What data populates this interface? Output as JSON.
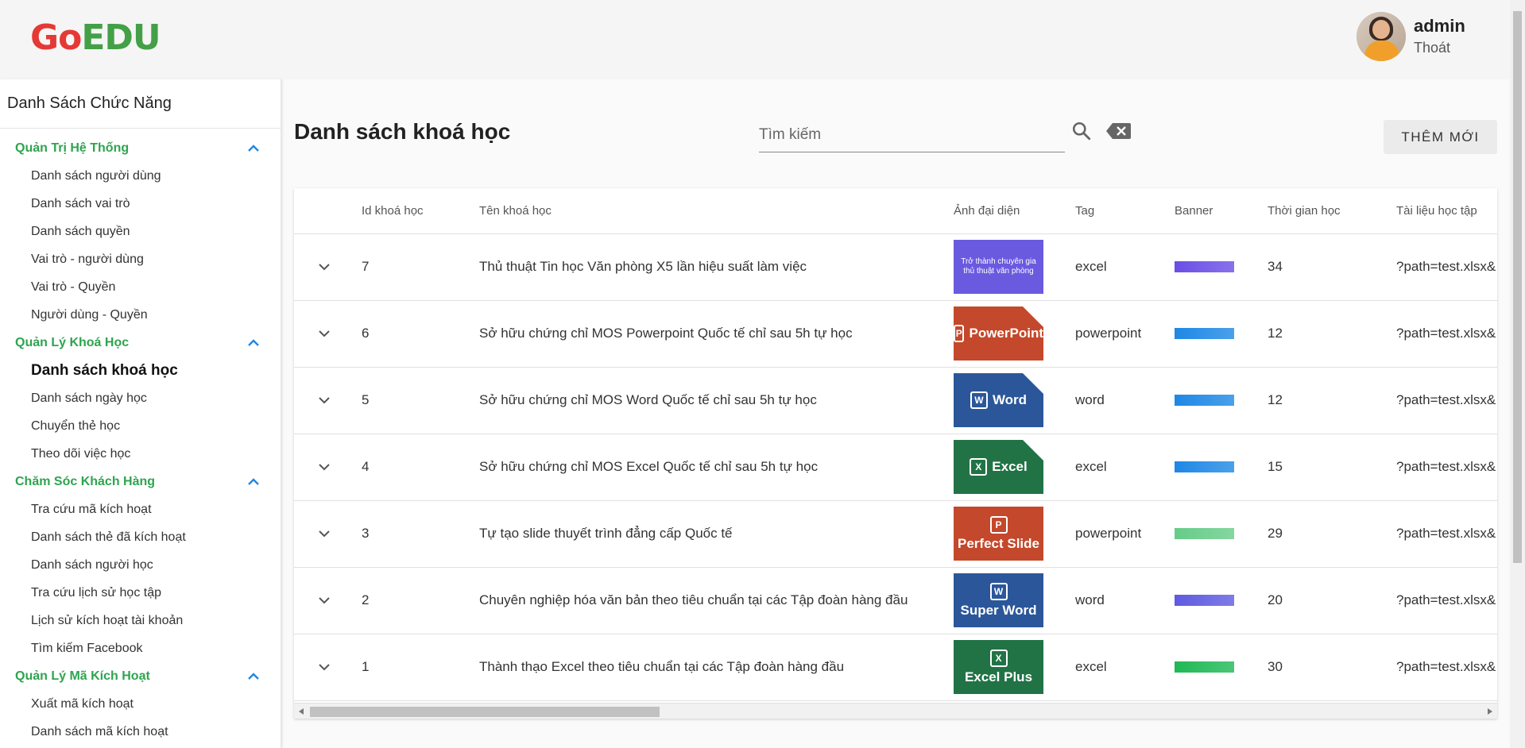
{
  "header": {
    "logo": {
      "go": "Go",
      "edu": "EDU"
    },
    "user": {
      "name": "admin",
      "logout": "Thoát"
    }
  },
  "sidebar": {
    "title": "Danh Sách Chức Năng",
    "groups": [
      {
        "label": "Quản Trị Hệ Thống",
        "items": [
          "Danh sách người dùng",
          "Danh sách vai trò",
          "Danh sách quyền",
          "Vai trò - người dùng",
          "Vai trò - Quyền",
          "Người dùng - Quyền"
        ]
      },
      {
        "label": "Quản Lý Khoá Học",
        "items": [
          "Danh sách khoá học",
          "Danh sách ngày học",
          "Chuyển thẻ học",
          "Theo dõi việc học"
        ]
      },
      {
        "label": "Chăm Sóc Khách Hàng",
        "items": [
          "Tra cứu mã kích hoạt",
          "Danh sách thẻ đã kích hoạt",
          "Danh sách người học",
          "Tra cứu lịch sử học tập",
          "Lịch sử kích hoạt tài khoản",
          "Tìm kiếm Facebook"
        ]
      },
      {
        "label": "Quản Lý Mã Kích Hoạt",
        "items": [
          "Xuất mã kích hoạt",
          "Danh sách mã kích hoạt"
        ]
      }
    ],
    "active_item": "Danh sách khoá học"
  },
  "main": {
    "title": "Danh sách khoá học",
    "search_placeholder": "Tìm kiếm",
    "search_value": "",
    "add_button": "THÊM MỚI"
  },
  "table": {
    "headers": [
      "",
      "Id khoá học",
      "Tên khoá học",
      "Ảnh đại diện",
      "Tag",
      "Banner",
      "Thời gian học",
      "Tài liệu học tập"
    ],
    "rows": [
      {
        "id": "7",
        "name": "Thủ thuật Tin học Văn phòng X5 lần hiệu suất làm việc",
        "thumb": {
          "kind": "office",
          "color": "#6a5ae0",
          "line1": "Trở thành chuyên gia",
          "line2": "thủ thuật văn phòng"
        },
        "tag": "excel",
        "banner_color": "#6b4ee6",
        "time": "34",
        "doc": "?path=test.xlsx&"
      },
      {
        "id": "6",
        "name": "Sở hữu chứng chỉ MOS Powerpoint Quốc tế chỉ sau 5h tự học",
        "thumb": {
          "kind": "mos",
          "color": "#c4482b",
          "sym": "P",
          "label": "PowerPoint"
        },
        "tag": "powerpoint",
        "banner_color": "#1e88e5",
        "time": "12",
        "doc": "?path=test.xlsx&"
      },
      {
        "id": "5",
        "name": "Sở hữu chứng chỉ MOS Word Quốc tế chỉ sau 5h tự học",
        "thumb": {
          "kind": "mos",
          "color": "#2b579a",
          "sym": "W",
          "label": "Word"
        },
        "tag": "word",
        "banner_color": "#1e88e5",
        "time": "12",
        "doc": "?path=test.xlsx&"
      },
      {
        "id": "4",
        "name": "Sở hữu chứng chỉ MOS Excel Quốc tế chỉ sau 5h tự học",
        "thumb": {
          "kind": "mos",
          "color": "#217346",
          "sym": "X",
          "label": "Excel"
        },
        "tag": "excel",
        "banner_color": "#1e88e5",
        "time": "15",
        "doc": "?path=test.xlsx&"
      },
      {
        "id": "3",
        "name": "Tự tạo slide thuyết trình đẳng cấp Quốc tế",
        "thumb": {
          "kind": "stack",
          "color": "#c4482b",
          "sym": "P",
          "label": "Perfect Slide"
        },
        "tag": "powerpoint",
        "banner_color": "#66cc88",
        "time": "29",
        "doc": "?path=test.xlsx&"
      },
      {
        "id": "2",
        "name": "Chuyên nghiệp hóa văn bản theo tiêu chuẩn tại các Tập đoàn hàng đầu",
        "thumb": {
          "kind": "stack",
          "color": "#2b579a",
          "sym": "W",
          "label": "Super Word"
        },
        "tag": "word",
        "banner_color": "#5e5be0",
        "time": "20",
        "doc": "?path=test.xlsx&"
      },
      {
        "id": "1",
        "name": "Thành thạo Excel theo tiêu chuẩn tại các Tập đoàn hàng đầu",
        "thumb": {
          "kind": "stack",
          "color": "#217346",
          "sym": "X",
          "label": "Excel Plus"
        },
        "tag": "excel",
        "banner_color": "#1fb855",
        "time": "30",
        "doc": "?path=test.xlsx&"
      }
    ]
  },
  "colors": {
    "accent": "#2ea44f",
    "chevron": "#1e88e5",
    "logo_go": "#e53935",
    "logo_edu": "#43a047"
  }
}
